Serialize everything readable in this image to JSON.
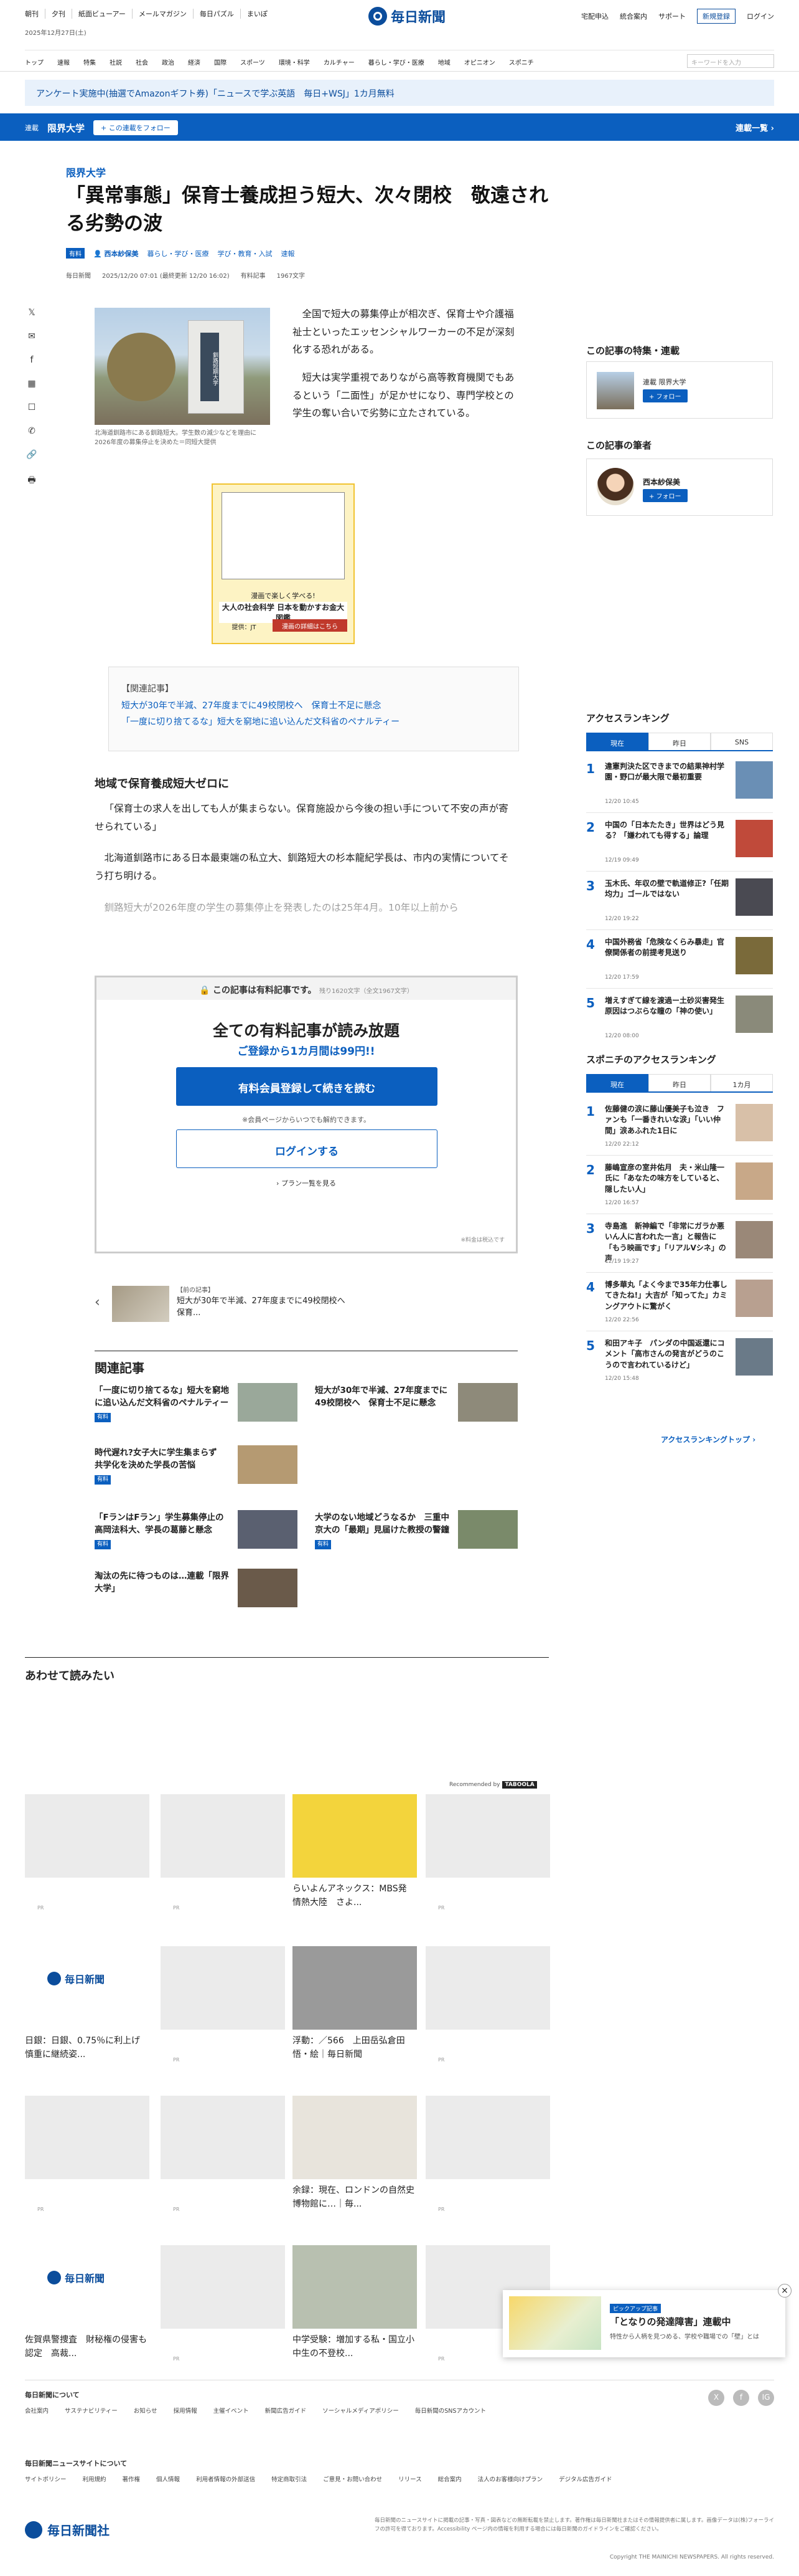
{
  "util": {
    "links": [
      "朝刊",
      "夕刊",
      "紙面ビューアー",
      "メールマガジン",
      "毎日パズル",
      "まいぽ"
    ],
    "right": [
      "宅配申込",
      "統合案内",
      "サポート"
    ],
    "register": "新規登録",
    "login": "ログイン",
    "date": "2025年12月27日(土)",
    "logo": "毎日新聞"
  },
  "nav": {
    "items": [
      "トップ",
      "速報",
      "特集",
      "社説",
      "社会",
      "政治",
      "経済",
      "国際",
      "スポーツ",
      "環境・科学",
      "カルチャー",
      "暮らし・学び・医療",
      "地域",
      "オピニオン",
      "スポニチ"
    ],
    "search_placeholder": "キーワードを入力"
  },
  "promo": "アンケート実施中(抽選でAmazonギフト券)「ニュースで学ぶ英語　毎日+WSJ」1カ月無料",
  "band": {
    "label": "連載",
    "title": "限界大学",
    "follow": "+ この連載をフォロー",
    "more": "連載一覧 ›"
  },
  "article": {
    "kicker": "限界大学",
    "title": "「異常事態」保育士養成担う短大、次々閉校　敬遠される劣勢の波",
    "badge": "有料",
    "author": "西本紗保美",
    "tags": [
      "暮らし・学び・医療",
      "学び・教育・入試",
      "速報"
    ],
    "source": "毎日新聞",
    "datetime": "2025/12/20 07:01 (最終更新 12/20 16:02)",
    "paid_label": "有料記事",
    "chars": "1967文字",
    "share": [
      "𝕏",
      "✉",
      "f",
      "▦",
      "☐",
      "✆",
      "🔗",
      "🖶"
    ],
    "caption": "北海道釧路市にある釧路短大。学生数の減少などを理由に2026年度の募集停止を決めた＝同短大提供",
    "photo_sign": "釧路短期大学",
    "lead": [
      "全国で短大の募集停止が相次ぎ、保育士や介護福祉士といったエッセンシャルワーカーの不足が深刻化する恐れがある。",
      "短大は実学重視でありながら高等教育機関でもあるという「二面性」が足かせになり、専門学校との学生の奪い合いで劣勢に立たされている。"
    ],
    "ad": {
      "a": "漫画で楽しく学べる!",
      "b": "大人の社会科学 日本を動かすお金大図鑑",
      "c": "提供：JT",
      "d": "漫画の詳細はこちら"
    },
    "related_head": "【関連記事】",
    "related_links": [
      "短大が30年で半減、27年度までに49校閉校へ　保育士不足に懸念",
      "「一度に切り捨てるな」短大を窮地に追い込んだ文科省のペナルティー"
    ],
    "subhead": "地域で保育養成短大ゼロに",
    "body": [
      "「保育士の求人を出しても人が集まらない。保育施設から今後の担い手について不安の声が寄せられている」",
      "北海道釧路市にある日本最東端の私立大、釧路短大の杉本龍紀学長は、市内の実情についてそう打ち明ける。",
      "釧路短大が2026年度の学生の募集停止を発表したのは25年4月。10年以上前から"
    ]
  },
  "paywall": {
    "top": "この記事は有料記事です。",
    "remain": "残り1620文字（全文1967文字）",
    "h1": "全ての有料記事が読み放題",
    "h2": "ご登録から1カ月間は99円!!",
    "cta": "有料会員登録して続きを読む",
    "note": "※会員ページからいつでも解約できます。",
    "login": "ログインする",
    "plans": "› プラン一覧を見る",
    "tax": "※料金は税込です"
  },
  "prev": {
    "label": "【前の記事】",
    "title": "短大が30年で半減、27年度までに49校閉校へ　保育..."
  },
  "related": {
    "heading": "関連記事",
    "items": [
      {
        "t": "「一度に切り捨てるな」短大を窮地に追い込んだ文科省のペナルティー",
        "tag": "有料"
      },
      {
        "t": "短大が30年で半減、27年度までに49校閉校へ　保育士不足に懸念",
        "tag": ""
      },
      {
        "t": "時代遅れ?女子大に学生集まらず　共学化を決めた学長の苦悩",
        "tag": "有料"
      },
      {
        "t": "",
        "tag": ""
      },
      {
        "t": "「FランはFラン」学生募集停止の高岡法科大、学長の葛藤と懸念",
        "tag": "有料"
      },
      {
        "t": "大学のない地域どうなるか　三重中京大の「最期」見届けた教授の警鐘",
        "tag": "有料"
      },
      {
        "t": "淘汰の先に待つものは…連載「限界大学」",
        "tag": ""
      }
    ]
  },
  "sidebar": {
    "feature_h": "この記事の特集・連載",
    "feature_label": "連載 限界大学",
    "feature_btn": "+ フォロー",
    "author_h": "この記事の筆者",
    "author_name": "西本紗保美",
    "author_btn": "+ フォロー",
    "access_h": "アクセスランキング",
    "access_tabs": [
      "現在",
      "昨日",
      "SNS"
    ],
    "access": [
      {
        "t": "違憲判決た区できまでの結果神村学園・野口が最大限で最初重要",
        "d": "12/20 10:45"
      },
      {
        "t": "中国の「日本たたき」世界はどう見る？「嫌われても得する」論理",
        "d": "12/19 09:49"
      },
      {
        "t": "玉木氏、年収の壁で軌道修正?「任期均力」ゴールではない",
        "d": "12/20 19:22"
      },
      {
        "t": "中国外務省「危険なくらみ暴走」官僚関係者の前提考見送り",
        "d": "12/20 17:59"
      },
      {
        "t": "増えすぎて線を渡過ー土砂災害発生　原因はつぶらな瞳の「神の使い」",
        "d": "12/20 08:00"
      }
    ],
    "sponichi_h": "スポニチのアクセスランキング",
    "sponichi_tabs": [
      "現在",
      "昨日",
      "1カ月"
    ],
    "sponichi": [
      {
        "t": "佐藤健の涙に藤山優美子も泣き　ファンも「一番きれいな涙」「いい仲間」涙あふれた1日に",
        "d": "12/20 22:12"
      },
      {
        "t": "藤嶋宣彦の室井佑月　夫・米山隆一氏に「あなたの味方をしていると、隠したい人」",
        "d": "12/20 16:57"
      },
      {
        "t": "寺島進　新神編で「非常にガラか悪いん人に言われた一言」と報告に「もう映画です」「リアルVシネ」の声",
        "d": "12/19 19:27"
      },
      {
        "t": "博多華丸「よく今まで35年力仕事してきたね!」大吉が「知ってた」カミングアウトに驚がく",
        "d": "12/20 22:56"
      },
      {
        "t": "和田アキ子　パンダの中国返還にコメント「高市さんの発言がどうのこうので言われているけど」",
        "d": "12/20 15:48"
      }
    ],
    "sponichi_more": "アクセスランキングトップ ›"
  },
  "read": {
    "heading": "あわせて読みたい",
    "recommended": "Recommended by",
    "rec_brand": "TABOOLA",
    "cards": [
      {
        "t": "",
        "pr": "PR"
      },
      {
        "t": "",
        "pr": "PR"
      },
      {
        "t": "らいよんアネックス：MBS発　情熱大陸　さよ...",
        "pr": ""
      },
      {
        "t": "",
        "pr": "PR"
      },
      {
        "t": "日銀：日銀、0.75％に利上げ　慎重に継続姿...",
        "pr": "",
        "logo": "毎日新聞"
      },
      {
        "t": "",
        "pr": "PR"
      },
      {
        "t": "浮動：／566　上田岳弘倉田悟・絵｜毎日新聞",
        "pr": ""
      },
      {
        "t": "",
        "pr": "PR"
      },
      {
        "t": "",
        "pr": "PR"
      },
      {
        "t": "",
        "pr": "PR"
      },
      {
        "t": "余録：現在、ロンドンの自然史博物館に…｜毎...",
        "pr": ""
      },
      {
        "t": "",
        "pr": "PR"
      },
      {
        "t": "佐賀県警捜査　財秘権の侵害も認定　高裁...",
        "pr": "",
        "logo": "毎日新聞"
      },
      {
        "t": "",
        "pr": "PR"
      },
      {
        "t": "中学受験：増加する私・国立小中生の不登校...",
        "pr": ""
      },
      {
        "t": "",
        "pr": "PR"
      }
    ]
  },
  "footer": {
    "h1": "毎日新聞について",
    "links1": [
      "会社案内",
      "サステナビリティー",
      "お知らせ",
      "採用情報",
      "主催イベント",
      "新聞広告ガイド",
      "ソーシャルメディアポリシー",
      "毎日新聞のSNSアカウント"
    ],
    "h2": "毎日新聞ニュースサイトについて",
    "links2": [
      "サイトポリシー",
      "利用規約",
      "著作権",
      "個人情報",
      "利用者情報の外部送信",
      "特定商取引法",
      "ご意見・お問い合わせ",
      "リリース",
      "総合案内",
      "法人のお客様向けプラン",
      "デジタル広告ガイド"
    ],
    "social": [
      "X",
      "f",
      "IG"
    ],
    "logo": "毎日新聞社",
    "note": "毎日新聞のニュースサイトに掲載の記事・写真・図表などの無断転載を禁止します。著作権は毎日新聞社またはその情報提供者に属します。画像データは(株)フォーライフの許可を得ております。Accessibility ページ内の情報を利用する場合には毎日新聞のガイドラインをご確認ください。",
    "copy": "Copyright THE MAINICHI NEWSPAPERS. All rights reserved."
  },
  "toast": {
    "tag": "ピックアップ記事",
    "title": "「となりの発達障害」連載中",
    "sub": "特性から人柄を見つめる、学校や職場での「壁」とは",
    "close": "×"
  }
}
